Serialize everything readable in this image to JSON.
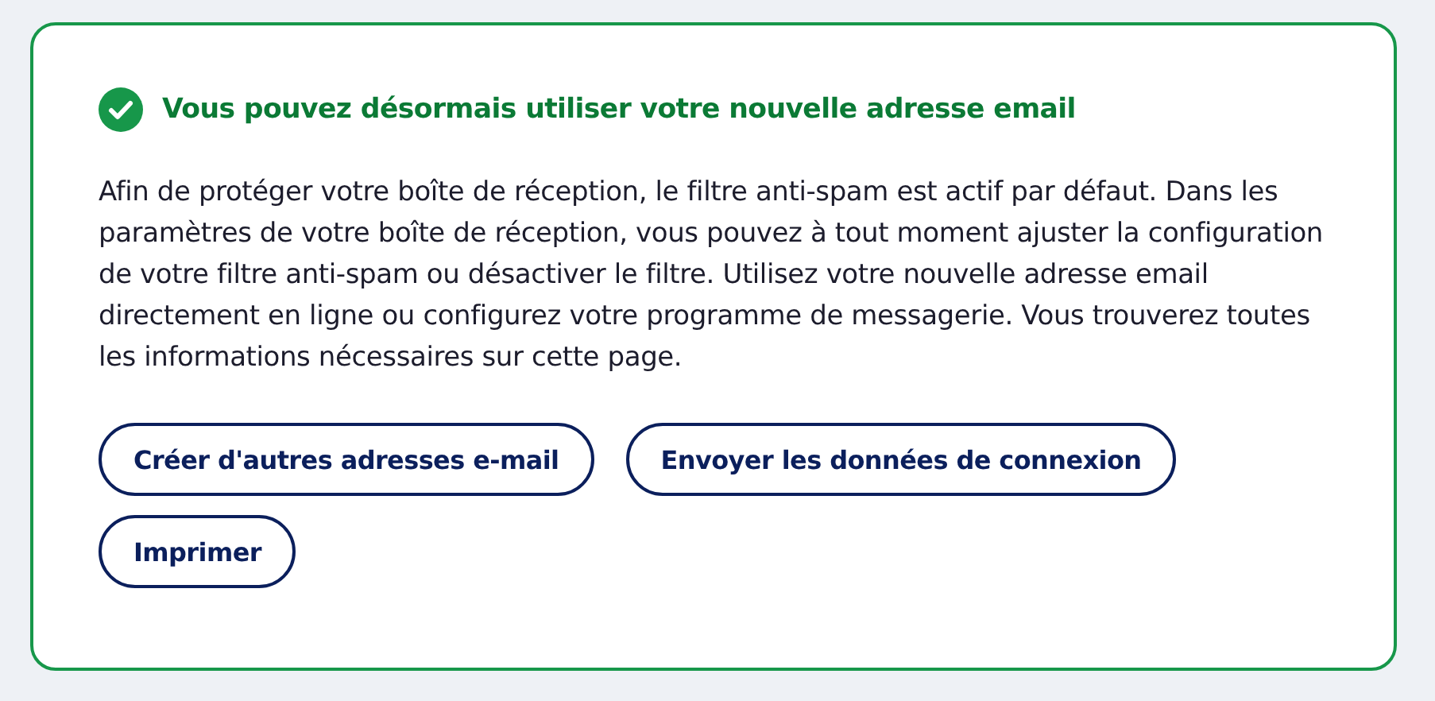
{
  "notice": {
    "success": true,
    "title": "Vous pouvez désormais utiliser votre nouvelle adresse email",
    "message": "Afin de protéger votre boîte de réception, le filtre anti-spam est actif par défaut. Dans les paramètres de votre boîte de réception, vous pouvez à tout moment ajuster la configuration de votre filtre anti-spam ou désactiver le filtre. Utilisez votre nouvelle adresse email directement en ligne ou configurez votre programme de messagerie. Vous trouverez toutes les informations nécessaires sur cette page.",
    "buttons": [
      {
        "label": "Créer d'autres adresses e-mail"
      },
      {
        "label": "Envoyer les données de connexion"
      },
      {
        "label": "Imprimer"
      }
    ]
  }
}
